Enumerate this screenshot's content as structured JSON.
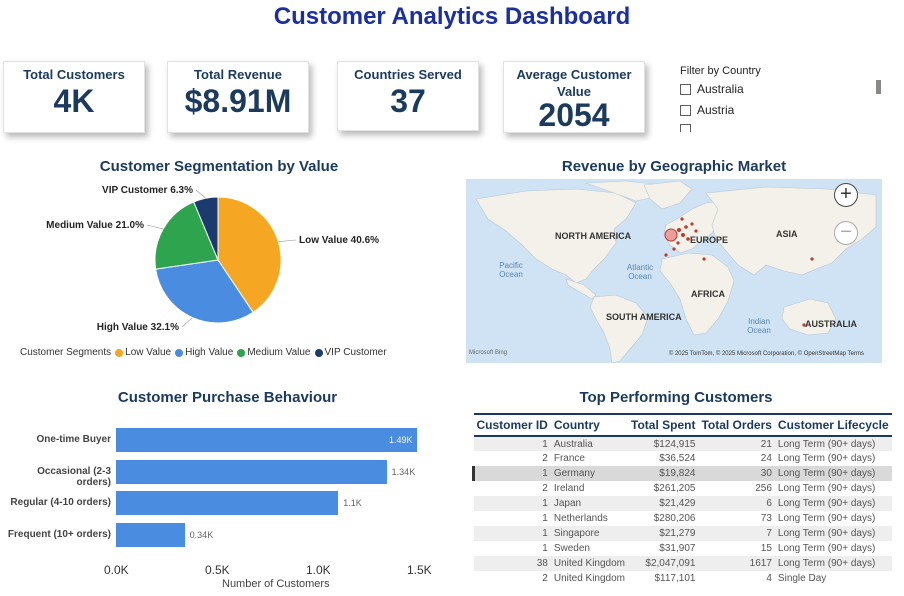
{
  "title": "Customer Analytics Dashboard",
  "kpis": [
    {
      "label": "Total Customers",
      "value": "4K"
    },
    {
      "label": "Total Revenue",
      "value": "$8.91M"
    },
    {
      "label": "Countries Served",
      "value": "37"
    },
    {
      "label": "Average Customer Value",
      "value": "2054"
    }
  ],
  "filter": {
    "title": "Filter by Country",
    "options": [
      "Australia",
      "Austria"
    ]
  },
  "segmentation": {
    "title": "Customer Segmentation by Value",
    "legend_title": "Customer  Segments",
    "slice_labels": [
      "Low Value 40.6%",
      "High Value 32.1%",
      "Medium Value 21.0%",
      "VIP Customer 6.3%"
    ]
  },
  "geo": {
    "title": "Revenue by Geographic Market",
    "labels": [
      "NORTH AMERICA",
      "EUROPE",
      "ASIA",
      "AFRICA",
      "SOUTH AMERICA",
      "AUSTRALIA"
    ],
    "ocean_labels": [
      "Pacific Ocean",
      "Atlantic Ocean",
      "Indian Ocean"
    ],
    "attribution": "© 2025 TomTom, © 2025 Microsoft Corporation, © OpenStreetMap  Terms",
    "bing": "Microsoft Bing"
  },
  "behaviour": {
    "title": "Customer Purchase Behaviour",
    "xlabel": "Number of Customers",
    "value_labels": [
      "1.49K",
      "1.34K",
      "1.1K",
      "0.34K"
    ]
  },
  "top_customers": {
    "title": "Top Performing Customers",
    "columns": [
      "Customer ID",
      "Country",
      "Total Spent",
      "Total Orders",
      "Customer Lifecycle"
    ],
    "rows": [
      [
        "1",
        "Australia",
        "$124,915",
        "21",
        "Long Term (90+ days)"
      ],
      [
        "2",
        "France",
        "$36,524",
        "24",
        "Long Term (90+ days)"
      ],
      [
        "1",
        "Germany",
        "$19,824",
        "30",
        "Long Term (90+ days)"
      ],
      [
        "2",
        "Ireland",
        "$261,205",
        "256",
        "Long Term (90+ days)"
      ],
      [
        "1",
        "Japan",
        "$21,429",
        "6",
        "Long Term (90+ days)"
      ],
      [
        "1",
        "Netherlands",
        "$280,206",
        "73",
        "Long Term (90+ days)"
      ],
      [
        "1",
        "Singapore",
        "$21,279",
        "7",
        "Long Term (90+ days)"
      ],
      [
        "1",
        "Sweden",
        "$31,907",
        "15",
        "Long Term (90+ days)"
      ],
      [
        "38",
        "United Kingdom",
        "$2,047,091",
        "1617",
        "Long Term (90+ days)"
      ],
      [
        "2",
        "United Kingdom",
        "$117,101",
        "4",
        "Single Day"
      ]
    ]
  },
  "chart_data": [
    {
      "type": "pie",
      "title": "Customer Segmentation by Value",
      "categories": [
        "Low Value",
        "High Value",
        "Medium Value",
        "VIP Customer"
      ],
      "values": [
        40.6,
        32.1,
        21.0,
        6.3
      ],
      "colors": [
        "#f5a623",
        "#4a8ce0",
        "#2ea44f",
        "#1b3a6e"
      ],
      "legend": "bottom"
    },
    {
      "type": "bar",
      "orientation": "horizontal",
      "title": "Customer Purchase Behaviour",
      "categories": [
        "One-time Buyer",
        "Occasional (2-3 orders)",
        "Regular (4-10 orders)",
        "Frequent (10+ orders)"
      ],
      "values": [
        1490,
        1340,
        1100,
        340
      ],
      "xlabel": "Number of Customers",
      "xticks": [
        "0.0K",
        "0.5K",
        "1.0K",
        "1.5K"
      ],
      "xlim": [
        0,
        1500
      ],
      "color": "#4a8ce0"
    }
  ]
}
